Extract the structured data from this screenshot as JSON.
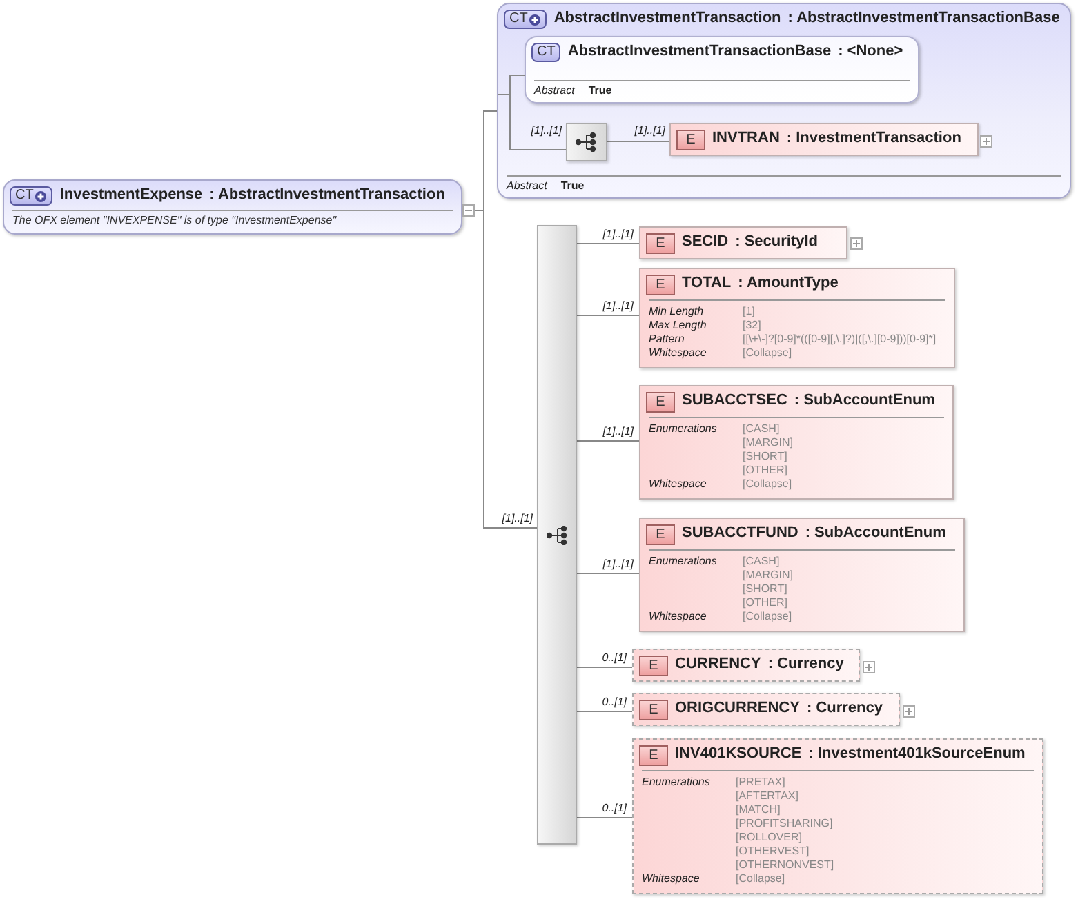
{
  "root": {
    "badge": "CT",
    "derived": true,
    "name": "InvestmentExpense",
    "type": ": AbstractInvestmentTransaction",
    "documentation": "The OFX element \"INVEXPENSE\" is of type \"InvestmentExpense\"",
    "expanded": true
  },
  "base_type": {
    "badge": "CT",
    "derived": true,
    "name": "AbstractInvestmentTransaction",
    "type": ": AbstractInvestmentTransactionBase",
    "inner_type": {
      "badge": "CT",
      "derived": false,
      "name": "AbstractInvestmentTransactionBase",
      "type": ": <None>",
      "properties": [
        {
          "label": "Abstract",
          "value": "True"
        }
      ]
    },
    "sequence": {
      "cardinality": "[1]..[1]"
    },
    "elements": [
      {
        "cardinality": "[1]..[1]",
        "badge": "E",
        "name": "INVTRAN",
        "type": ": InvestmentTransaction",
        "optional": false,
        "expanded": false
      }
    ],
    "properties": [
      {
        "label": "Abstract",
        "value": "True"
      }
    ]
  },
  "sequence": {
    "cardinality": "[1]..[1]"
  },
  "elements": [
    {
      "cardinality": "[1]..[1]",
      "badge": "E",
      "name": "SECID",
      "type": ": SecurityId",
      "optional": false,
      "expanded": false
    },
    {
      "cardinality": "[1]..[1]",
      "badge": "E",
      "name": "TOTAL",
      "type": ": AmountType",
      "optional": false,
      "facets": [
        {
          "label": "Min Length",
          "values": [
            "[1]"
          ]
        },
        {
          "label": "Max Length",
          "values": [
            "[32]"
          ]
        },
        {
          "label": "Pattern",
          "values": [
            "[[\\+\\-]?[0-9]*(([0-9][,\\.]?)|([,\\.][0-9]))[0-9]*]"
          ]
        },
        {
          "label": "Whitespace",
          "values": [
            "[Collapse]"
          ]
        }
      ]
    },
    {
      "cardinality": "[1]..[1]",
      "badge": "E",
      "name": "SUBACCTSEC",
      "type": ": SubAccountEnum",
      "optional": false,
      "facets": [
        {
          "label": "Enumerations",
          "values": [
            "[CASH]",
            "[MARGIN]",
            "[SHORT]",
            "[OTHER]"
          ]
        },
        {
          "label": "Whitespace",
          "values": [
            "[Collapse]"
          ]
        }
      ]
    },
    {
      "cardinality": "[1]..[1]",
      "badge": "E",
      "name": "SUBACCTFUND",
      "type": ": SubAccountEnum",
      "optional": false,
      "facets": [
        {
          "label": "Enumerations",
          "values": [
            "[CASH]",
            "[MARGIN]",
            "[SHORT]",
            "[OTHER]"
          ]
        },
        {
          "label": "Whitespace",
          "values": [
            "[Collapse]"
          ]
        }
      ]
    },
    {
      "cardinality": "0..[1]",
      "badge": "E",
      "name": "CURRENCY",
      "type": ": Currency",
      "optional": true,
      "expanded": false
    },
    {
      "cardinality": "0..[1]",
      "badge": "E",
      "name": "ORIGCURRENCY",
      "type": ": Currency",
      "optional": true,
      "expanded": false
    },
    {
      "cardinality": "0..[1]",
      "badge": "E",
      "name": "INV401KSOURCE",
      "type": ": Investment401kSourceEnum",
      "optional": true,
      "facets": [
        {
          "label": "Enumerations",
          "values": [
            "[PRETAX]",
            "[AFTERTAX]",
            "[MATCH]",
            "[PROFITSHARING]",
            "[ROLLOVER]",
            "[OTHERVEST]",
            "[OTHERNONVEST]"
          ]
        },
        {
          "label": "Whitespace",
          "values": [
            "[Collapse]"
          ]
        }
      ]
    }
  ]
}
